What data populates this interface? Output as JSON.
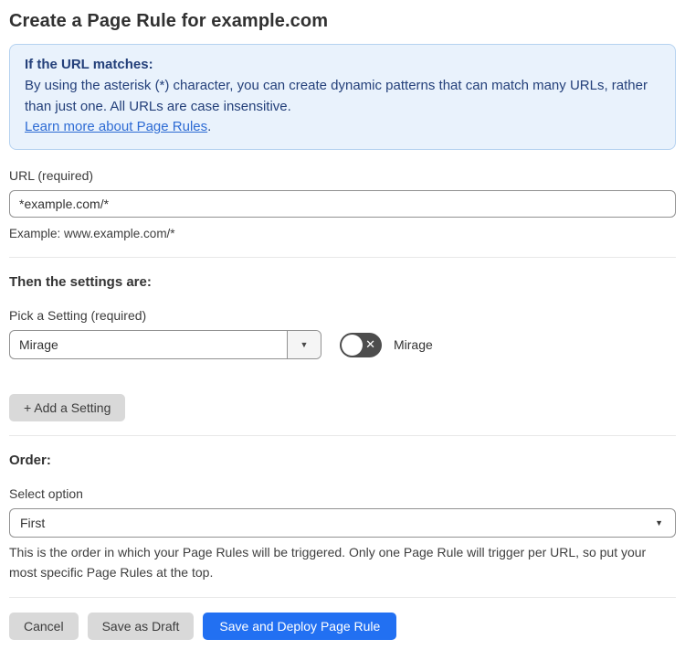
{
  "page": {
    "title": "Create a Page Rule for example.com"
  },
  "info_box": {
    "heading": "If the URL matches:",
    "body": "By using the asterisk (*) character, you can create dynamic patterns that can match many URLs, rather than just one. All URLs are case insensitive.",
    "link_text": "Learn more about Page Rules",
    "link_suffix": "."
  },
  "url_section": {
    "label": "URL (required)",
    "value": "*example.com/*",
    "helper": "Example: www.example.com/*"
  },
  "settings_section": {
    "heading": "Then the settings are:",
    "picker_label": "Pick a Setting (required)",
    "selected_setting": "Mirage",
    "toggle_label": "Mirage",
    "toggle_state": "off",
    "add_button_label": "+ Add a Setting"
  },
  "order_section": {
    "heading": "Order:",
    "label": "Select option",
    "selected_option": "First",
    "helper": "This is the order in which your Page Rules will be triggered. Only one Page Rule will trigger per URL, so put your most specific Page Rules at the top."
  },
  "footer": {
    "cancel_label": "Cancel",
    "save_draft_label": "Save as Draft",
    "save_deploy_label": "Save and Deploy Page Rule"
  },
  "icons": {
    "dropdown_arrow": "▼",
    "toggle_x": "✕"
  },
  "colors": {
    "info_box_bg": "#e9f2fc",
    "info_box_border": "#b5d2f0",
    "info_text": "#24407a",
    "link": "#2d6bd4",
    "primary_button": "#2270f2",
    "gray_button": "#d9d9d9",
    "toggle_off_bg": "#4d4d4d",
    "input_border": "#919191",
    "divider": "#e8e8e8"
  }
}
